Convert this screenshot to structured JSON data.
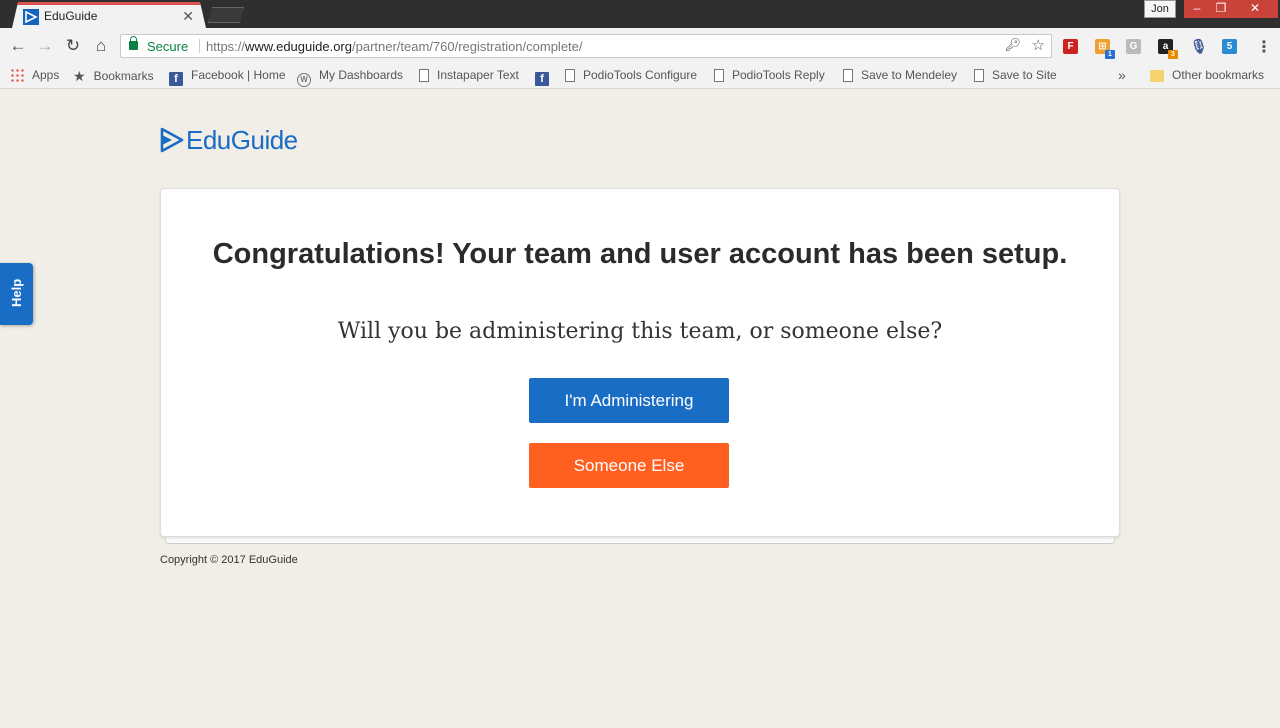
{
  "browser": {
    "tab_title": "EduGuide",
    "tab_close": "✕",
    "profile_name": "Jon",
    "window_controls": {
      "minimize": "–",
      "maximize": "❐",
      "close": "✕"
    },
    "nav": {
      "back": "←",
      "forward": "→",
      "reload": "↻",
      "home": "⌂"
    },
    "address": {
      "secure_label": "Secure",
      "url_scheme": "https://",
      "url_host": "www.eduguide.org",
      "url_path": "/partner/team/760/registration/complete/"
    },
    "extensions": [
      {
        "name": "flipboard-extension-icon",
        "glyph": "F"
      },
      {
        "name": "rss-extension-icon",
        "glyph": "⊞",
        "badge": "1"
      },
      {
        "name": "g-extension-icon",
        "glyph": "G"
      },
      {
        "name": "amazon-extension-icon",
        "glyph": "a",
        "badge": "3"
      },
      {
        "name": "microphone-extension-icon",
        "glyph": "🎙"
      },
      {
        "name": "five-extension-icon",
        "glyph": "5"
      }
    ],
    "menu_glyph": "⋮",
    "bookmarks": {
      "apps": "Apps",
      "bookmarks": "Bookmarks",
      "facebook_home": "Facebook | Home",
      "my_dashboards": "My Dashboards",
      "instapaper_text": "Instapaper Text",
      "podiotools_configure": "PodioTools Configure",
      "podiotools_reply": "PodioTools Reply",
      "save_to_mendeley": "Save to Mendeley",
      "save_to_site": "Save to Site",
      "overflow": "»",
      "other_bookmarks": "Other bookmarks"
    }
  },
  "page": {
    "help_label": "Help",
    "logo_text": "EduGuide",
    "headline": "Congratulations! Your team and user account has been setup.",
    "question": "Will you be administering this team, or someone else?",
    "admin_button": "I'm Administering",
    "someone_else_button": "Someone Else",
    "copyright": "Copyright © 2017 EduGuide"
  },
  "colors": {
    "brand_blue": "#1a6dc5",
    "accent_orange": "#ff5f1f",
    "page_background": "#f1ede7",
    "secure_green": "#0b8043"
  }
}
